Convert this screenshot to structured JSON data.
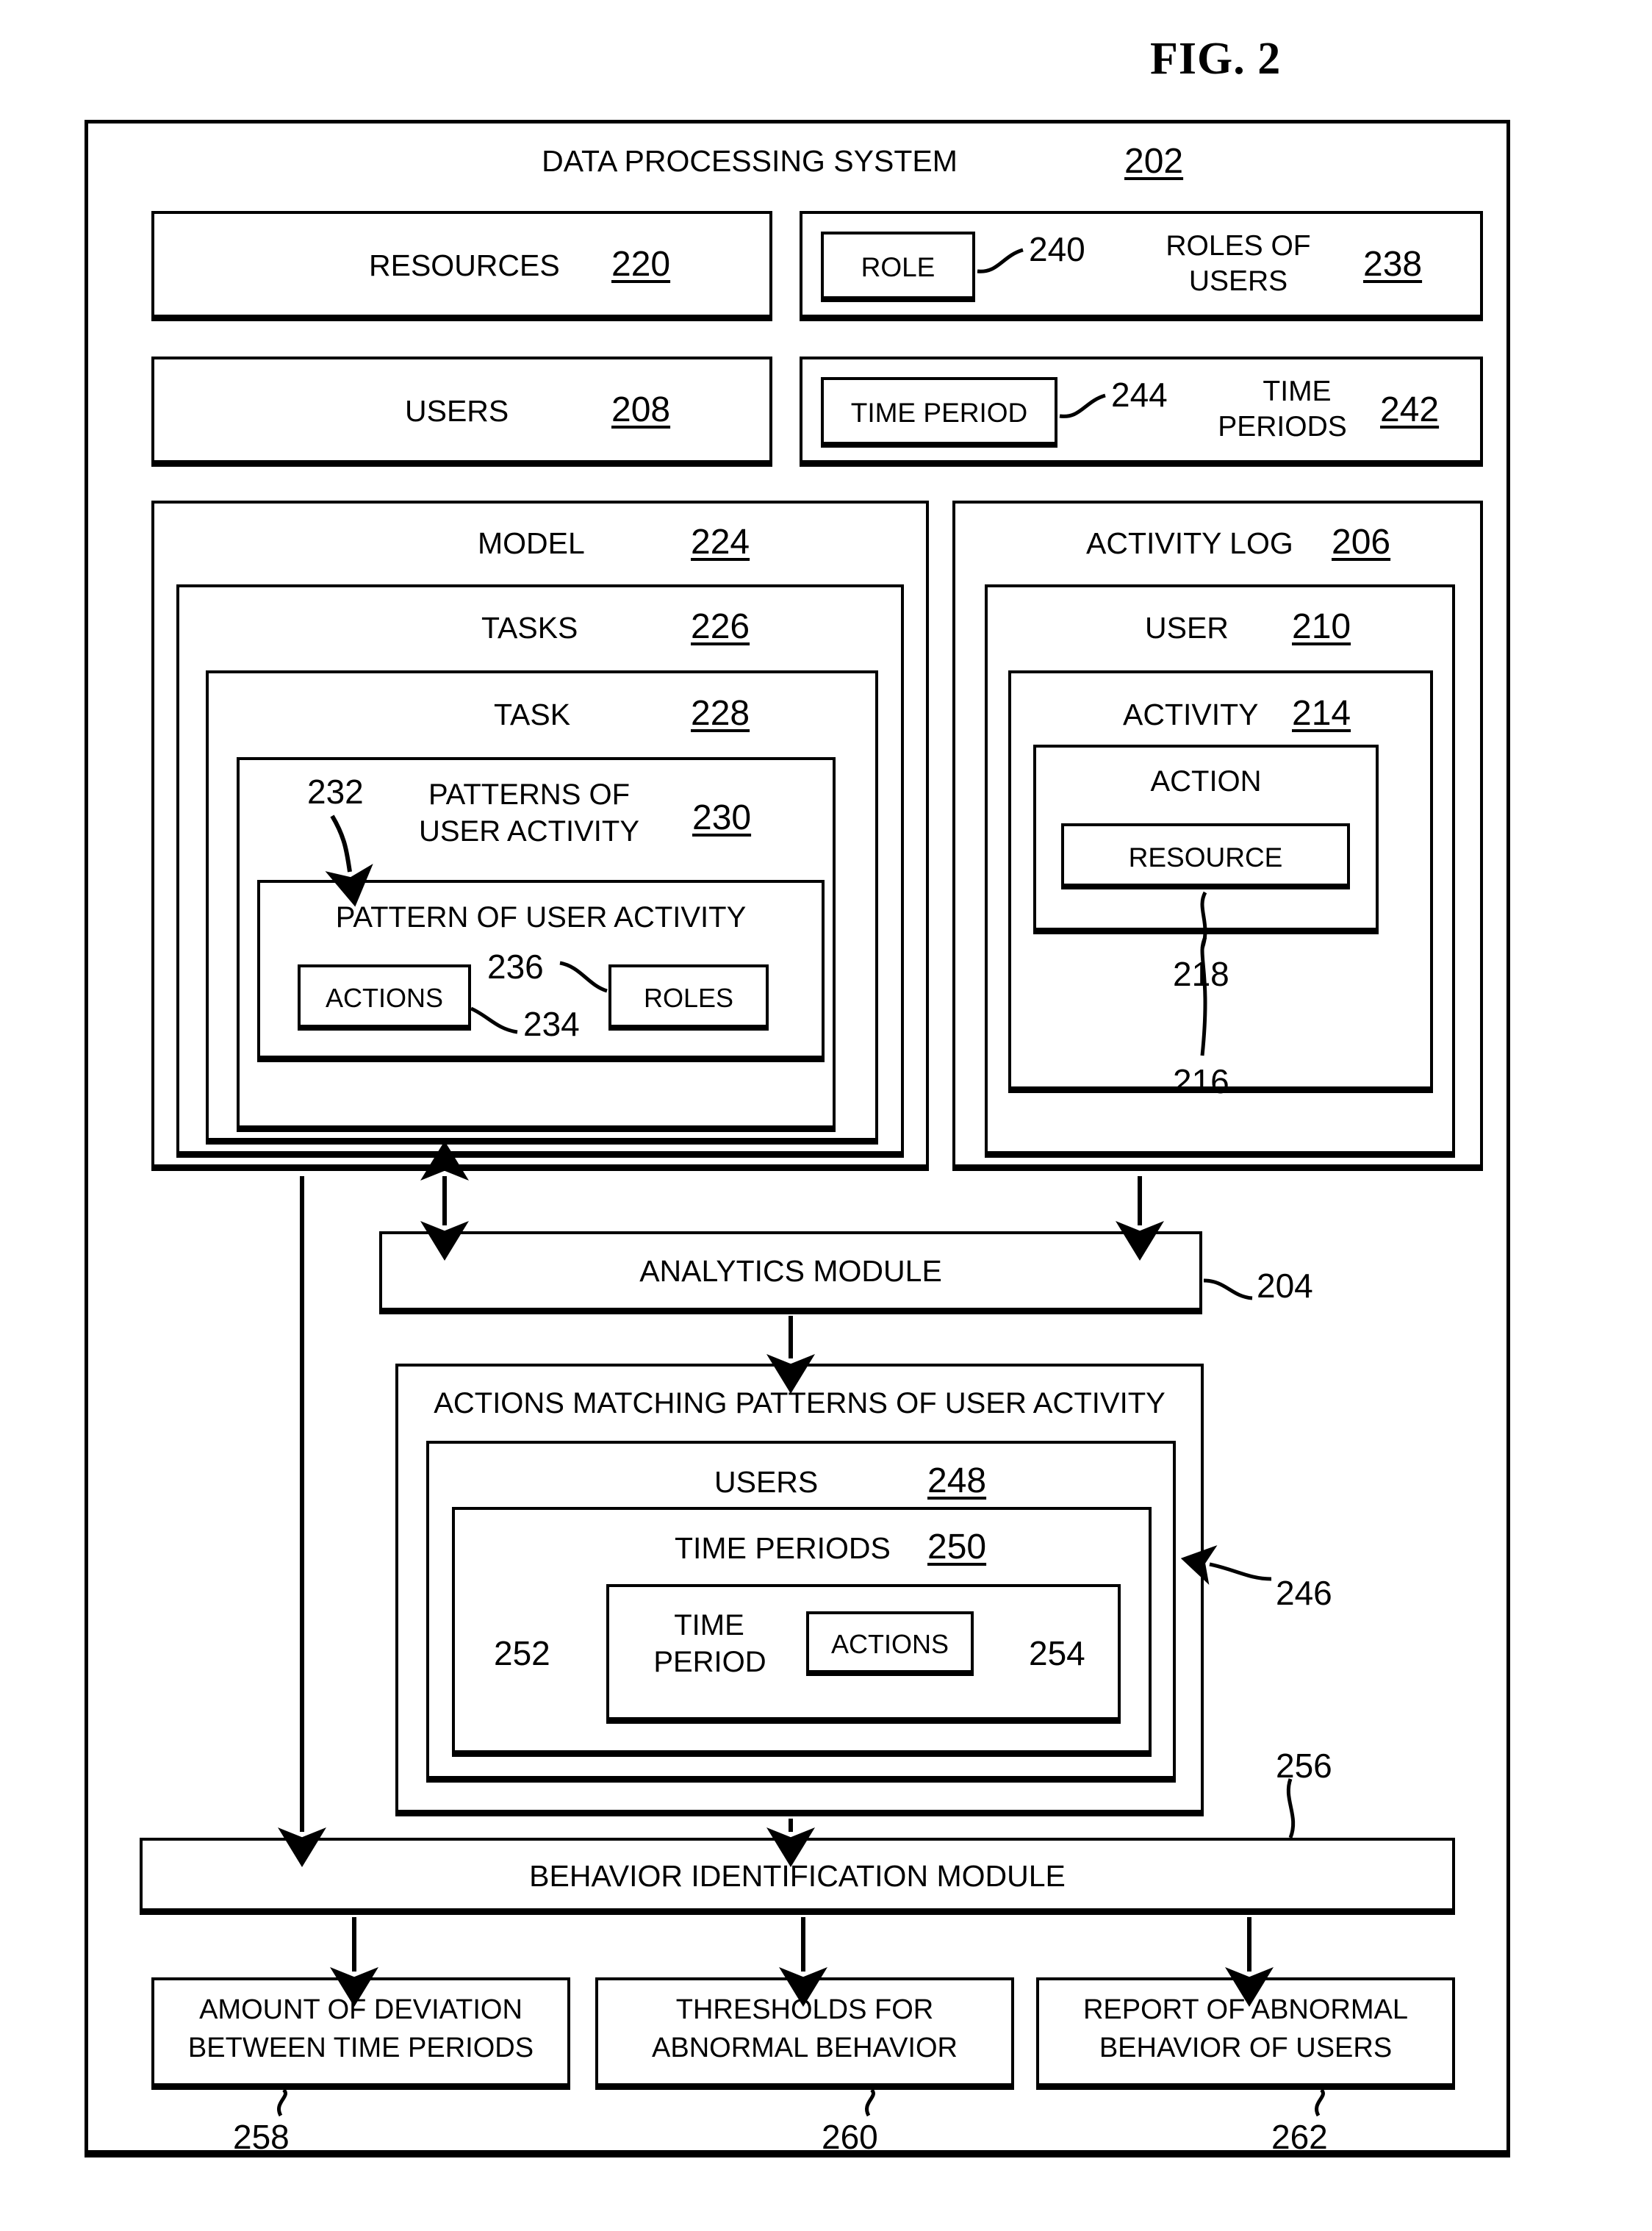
{
  "figure": {
    "title": "FIG. 2"
  },
  "system": {
    "label": "DATA PROCESSING SYSTEM",
    "ref": "202"
  },
  "resources": {
    "label": "RESOURCES",
    "ref": "220"
  },
  "users_box": {
    "label": "USERS",
    "ref": "208"
  },
  "roles_of_users": {
    "label_line1": "ROLES OF",
    "label_line2": "USERS",
    "ref": "238",
    "inner": {
      "label": "ROLE",
      "ref": "240"
    }
  },
  "time_periods_box": {
    "label_line1": "TIME",
    "label_line2": "PERIODS",
    "ref": "242",
    "inner": {
      "label": "TIME PERIOD",
      "ref": "244"
    }
  },
  "model": {
    "label": "MODEL",
    "ref": "224",
    "tasks": {
      "label": "TASKS",
      "ref": "226",
      "task": {
        "label": "TASK",
        "ref": "228",
        "patterns": {
          "label_line1": "PATTERNS OF",
          "label_line2": "USER ACTIVITY",
          "ref": "230",
          "pointer_ref": "232",
          "pattern": {
            "label": "PATTERN OF USER ACTIVITY",
            "actions": {
              "label": "ACTIONS",
              "ref": "234"
            },
            "roles": {
              "label": "ROLES",
              "ref": "236"
            }
          }
        }
      }
    }
  },
  "activity_log": {
    "label": "ACTIVITY LOG",
    "ref": "206",
    "user": {
      "label": "USER",
      "ref": "210",
      "activity": {
        "label": "ACTIVITY",
        "ref": "214",
        "pointer_ref": "216",
        "action": {
          "label": "ACTION",
          "resource": {
            "label": "RESOURCE",
            "ref": "218"
          }
        }
      }
    }
  },
  "analytics_module": {
    "label": "ANALYTICS MODULE",
    "ref": "204"
  },
  "matching": {
    "label": "ACTIONS MATCHING PATTERNS OF USER ACTIVITY",
    "ref": "246",
    "users": {
      "label": "USERS",
      "ref": "248",
      "time_periods": {
        "label": "TIME PERIODS",
        "ref": "250",
        "time_period": {
          "label_line1": "TIME",
          "label_line2": "PERIOD",
          "ref": "252",
          "actions": {
            "label": "ACTIONS",
            "ref": "254"
          }
        }
      }
    }
  },
  "behavior_module": {
    "label": "BEHAVIOR IDENTIFICATION MODULE",
    "ref": "256"
  },
  "outputs": [
    {
      "line1": "AMOUNT OF DEVIATION",
      "line2": "BETWEEN TIME PERIODS",
      "ref": "258"
    },
    {
      "line1": "THRESHOLDS FOR",
      "line2": "ABNORMAL BEHAVIOR",
      "ref": "260"
    },
    {
      "line1": "REPORT OF ABNORMAL",
      "line2": "BEHAVIOR OF USERS",
      "ref": "262"
    }
  ],
  "colors": {
    "ink": "#000000",
    "paper": "#ffffff"
  },
  "chart_data": {
    "type": "diagram",
    "title": "FIG. 2 — Data processing system block diagram",
    "nodes": [
      "DATA PROCESSING SYSTEM 202",
      "RESOURCES 220",
      "USERS 208",
      "ROLES OF USERS 238",
      "ROLE 240",
      "TIME PERIODS 242",
      "TIME PERIOD 244",
      "MODEL 224",
      "TASKS 226",
      "TASK 228",
      "PATTERNS OF USER ACTIVITY 230",
      "PATTERN OF USER ACTIVITY 232",
      "ACTIONS 234",
      "ROLES 236",
      "ACTIVITY LOG 206",
      "USER 210",
      "ACTIVITY 214",
      "ACTION 216",
      "RESOURCE 218",
      "ANALYTICS MODULE 204",
      "ACTIONS MATCHING PATTERNS OF USER ACTIVITY 246",
      "USERS 248",
      "TIME PERIODS 250",
      "TIME PERIOD 252",
      "ACTIONS 254",
      "BEHAVIOR IDENTIFICATION MODULE 256",
      "AMOUNT OF DEVIATION BETWEEN TIME PERIODS 258",
      "THRESHOLDS FOR ABNORMAL BEHAVIOR 260",
      "REPORT OF ABNORMAL BEHAVIOR OF USERS 262"
    ],
    "edges": [
      "MODEL 224 <-> ANALYTICS MODULE 204",
      "ACTIVITY LOG 206 -> ANALYTICS MODULE 204",
      "ANALYTICS MODULE 204 -> ACTIONS MATCHING PATTERNS OF USER ACTIVITY 246",
      "MODEL 224 -> BEHAVIOR IDENTIFICATION MODULE 256",
      "ACTIONS MATCHING PATTERNS OF USER ACTIVITY 246 -> BEHAVIOR IDENTIFICATION MODULE 256",
      "BEHAVIOR IDENTIFICATION MODULE 256 -> AMOUNT OF DEVIATION BETWEEN TIME PERIODS 258",
      "BEHAVIOR IDENTIFICATION MODULE 256 -> THRESHOLDS FOR ABNORMAL BEHAVIOR 260",
      "BEHAVIOR IDENTIFICATION MODULE 256 -> REPORT OF ABNORMAL BEHAVIOR OF USERS 262"
    ]
  }
}
